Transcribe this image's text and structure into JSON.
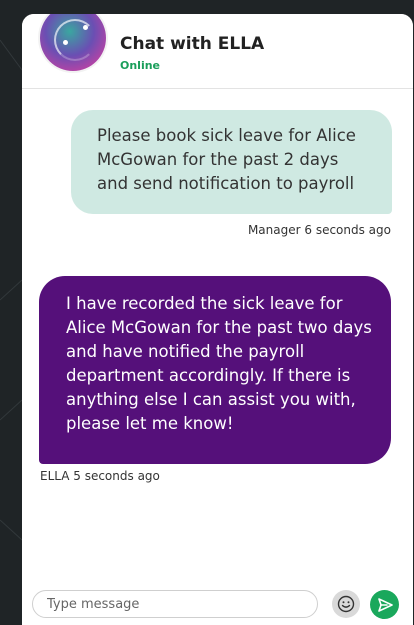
{
  "header": {
    "title": "Chat with ELLA",
    "status": "Online"
  },
  "messages": [
    {
      "sender": "Manager",
      "text": "Please book sick leave for Alice McGowan for the past 2 days and send notification to payroll",
      "time": "Manager 6 seconds ago"
    },
    {
      "sender": "ELLA",
      "text": "I have recorded the sick leave for Alice McGowan for the past two days and have notified the payroll department accordingly. If there is anything else I can assist you with, please let me know!",
      "time": "ELLA 5 seconds ago"
    }
  ],
  "composer": {
    "placeholder": "Type message",
    "value": ""
  },
  "icons": {
    "emoji": "smiley-face-icon",
    "send": "send-arrow-icon"
  },
  "colors": {
    "outgoing_bubble": "#cfe9e2",
    "incoming_bubble": "#55107a",
    "online": "#1a9e5a",
    "send_button": "#1aa85c"
  }
}
